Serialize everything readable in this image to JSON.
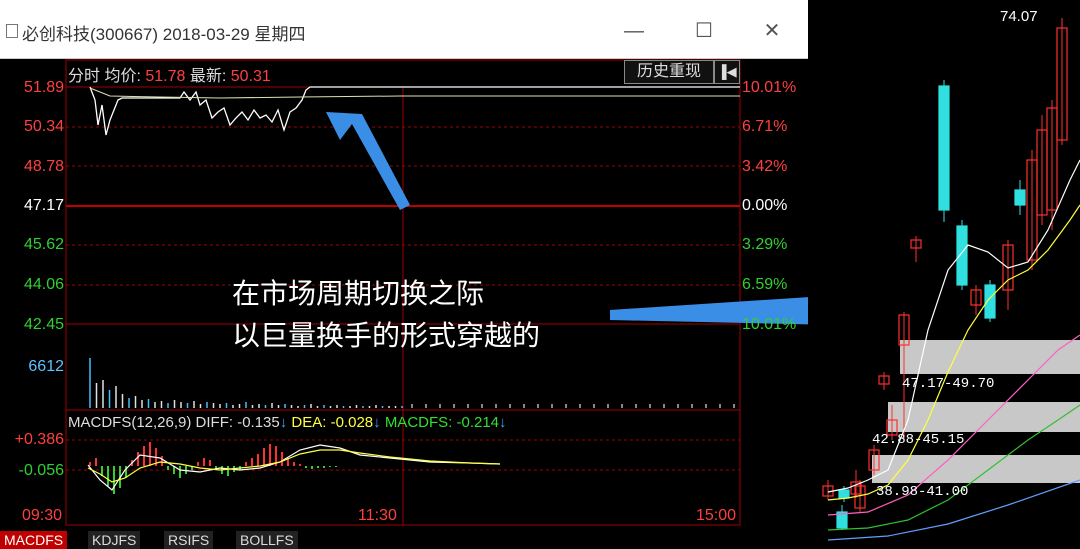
{
  "window": {
    "title": "必创科技(300667) 2018-03-29 星期四",
    "min_glyph": "—",
    "max_glyph": "☐",
    "close_glyph": "✕"
  },
  "intraday": {
    "tab_label": "分时",
    "avg_label": "均价:",
    "avg_value": "51.78",
    "last_label": "最新:",
    "last_value": "50.31",
    "history_button": "历史重现",
    "history_arrow": "▐◀",
    "price_axis": [
      "51.89",
      "50.34",
      "48.78",
      "47.17",
      "45.62",
      "44.06",
      "42.45"
    ],
    "pct_axis": [
      "10.01%",
      "6.71%",
      "3.42%",
      "0.00%",
      "3.29%",
      "6.59%",
      "10.01%"
    ],
    "volume_label": "6612",
    "macd_axis": [
      "+0.386",
      "-0.056"
    ],
    "times": [
      "09:30",
      "11:30",
      "15:00"
    ]
  },
  "macd": {
    "name": "MACDFS(12,26,9)",
    "diff": "DIFF: -0.135",
    "dea": "DEA: -0.028",
    "macdfs": "MACDFS: -0.214",
    "arrow": "↓"
  },
  "tabs": [
    "MACDFS",
    "KDJFS",
    "RSIFS",
    "BOLLFS"
  ],
  "annotation": {
    "line1": "在市场周期切换之际",
    "line2": "以巨量换手的形式穿越的"
  },
  "kline": {
    "high_label": "74.07",
    "zones": [
      "47.17-49.70",
      "42.88-45.15",
      "38.98-41.00"
    ]
  },
  "colors": {
    "up": "#ff3030",
    "down": "#30e0e0",
    "grid": "#a00000",
    "annotation_arrow": "#3a8ee6"
  }
}
